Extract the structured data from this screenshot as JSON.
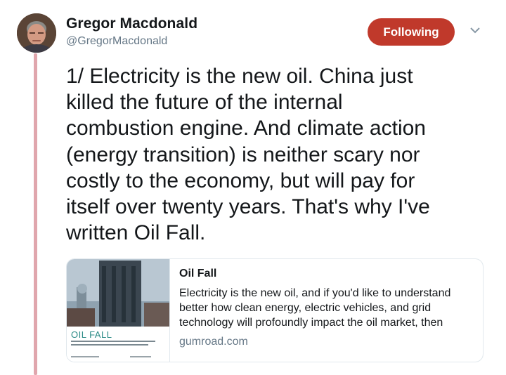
{
  "author": {
    "name": "Gregor Macdonald",
    "handle": "@GregorMacdonald"
  },
  "follow_button": {
    "label": "Following",
    "color": "#c0392b"
  },
  "tweet": {
    "text": "1/ Electricity is the new oil. China just\nkilled the future of the internal\ncombustion engine. And climate action\n(energy transition) is neither scary nor\ncostly to the economy, but will pay for\nitself over twenty years. That's why I've\nwritten Oil Fall."
  },
  "card": {
    "title": "Oil Fall",
    "description": "Electricity is the new oil, and if you'd like to understand better how clean energy, electric vehicles, and grid technology will profoundly impact the oil market, then",
    "domain": "gumroad.com",
    "cover_title": "OIL FALL"
  },
  "colors": {
    "thread_line": "#e0a6ad",
    "secondary_text": "#657786",
    "cover_accent": "#2a8a86"
  }
}
